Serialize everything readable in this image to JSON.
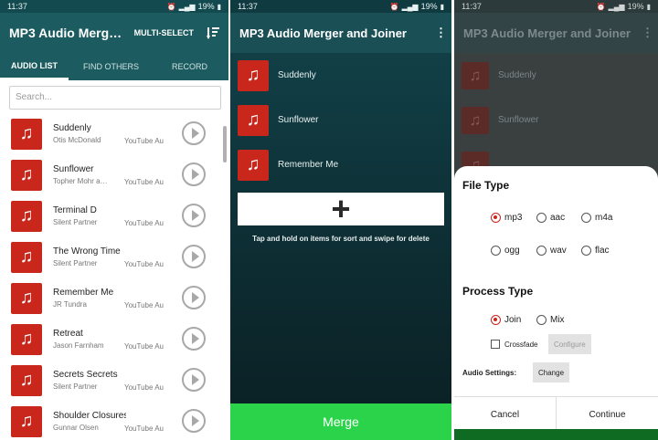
{
  "screen1": {
    "status": {
      "time": "11:37",
      "battery": "19%"
    },
    "appbar": {
      "title": "MP3 Audio Merg…",
      "multi_select": "MULTI-SELECT"
    },
    "tabs": [
      "AUDIO LIST",
      "FIND OTHERS",
      "RECORD"
    ],
    "search": {
      "placeholder": "Search..."
    },
    "items": [
      {
        "title": "Suddenly",
        "artist": "Otis McDonald",
        "source": "YouTube Au"
      },
      {
        "title": "Sunflower",
        "artist": "Topher Mohr a…",
        "source": "YouTube Au"
      },
      {
        "title": "Terminal D",
        "artist": "Silent Partner",
        "source": "YouTube Au"
      },
      {
        "title": "The Wrong Time",
        "artist": "Silent Partner",
        "source": "YouTube Au"
      },
      {
        "title": "Remember Me",
        "artist": "JR Tundra",
        "source": "YouTube Au"
      },
      {
        "title": "Retreat",
        "artist": "Jason Farnham",
        "source": "YouTube Au"
      },
      {
        "title": "Secrets Secrets",
        "artist": "Silent Partner",
        "source": "YouTube Au"
      },
      {
        "title": "Shoulder Closures",
        "artist": "Gunnar Olsen",
        "source": "YouTube Au"
      }
    ]
  },
  "screen2": {
    "status": {
      "time": "11:37",
      "battery": "19%"
    },
    "appbar": {
      "title": "MP3 Audio Merger and Joiner"
    },
    "items": [
      "Suddenly",
      "Sunflower",
      "Remember Me"
    ],
    "add_symbol": "+",
    "hint": "Tap and hold on items for sort and swipe for delete",
    "merge_label": "Merge"
  },
  "screen3": {
    "status": {
      "time": "11:37",
      "battery": "19%"
    },
    "appbar": {
      "title": "MP3 Audio Merger and Joiner"
    },
    "items": [
      "Suddenly",
      "Sunflower"
    ],
    "dialog": {
      "file_type_title": "File Type",
      "file_types": [
        "mp3",
        "aac",
        "m4a",
        "ogg",
        "wav",
        "flac"
      ],
      "file_type_selected": "mp3",
      "process_type_title": "Process Type",
      "process_types": [
        "Join",
        "Mix"
      ],
      "process_type_selected": "Join",
      "crossfade_label": "Crossfade",
      "configure_label": "Configure",
      "audio_settings_label": "Audio Settings:",
      "change_label": "Change",
      "cancel_label": "Cancel",
      "continue_label": "Continue"
    }
  },
  "colors": {
    "teal": "#1c5c60",
    "red": "#c9261c",
    "green": "#2bd34a"
  },
  "icons": {
    "note": "♫"
  }
}
